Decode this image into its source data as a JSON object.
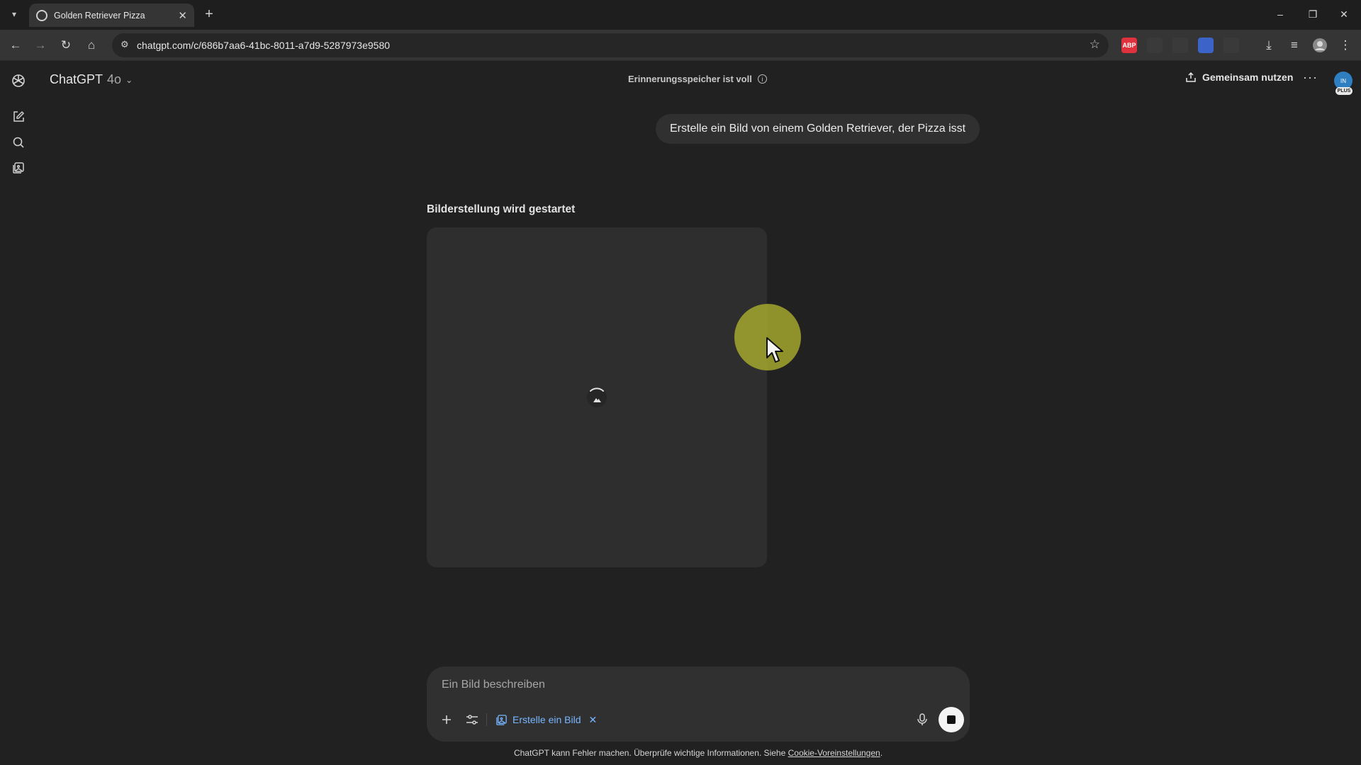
{
  "browser": {
    "tab_title": "Golden Retriever Pizza",
    "url": "chatgpt.com/c/686b7aa6-41bc-8011-a7d9-5287973e9580",
    "extensions": [
      {
        "name": "abp-extension-icon",
        "label": "ABP",
        "color": "#e0323c"
      },
      {
        "name": "swoosh-extension-icon",
        "label": "",
        "color": "#3a3a3a"
      },
      {
        "name": "camera-extension-icon",
        "label": "",
        "color": "#3a3a3a"
      },
      {
        "name": "shield-extension-icon",
        "label": "",
        "color": "#3c63c8"
      },
      {
        "name": "puzzle-extension-icon",
        "label": "",
        "color": "#3a3a3a"
      }
    ]
  },
  "header": {
    "model_name": "ChatGPT",
    "model_version": "4o",
    "memory_notice": "Erinnerungsspeicher ist voll",
    "share_label": "Gemeinsam nutzen",
    "avatar_initials": "IN",
    "plan_badge": "PLUS"
  },
  "conversation": {
    "user_message": "Erstelle ein Bild von einem Golden Retriever, der Pizza isst",
    "image_status": "Bilderstellung wird gestartet"
  },
  "composer": {
    "placeholder": "Ein Bild beschreiben",
    "tool_pill": "Erstelle ein Bild"
  },
  "footer": {
    "disclaimer": "ChatGPT kann Fehler machen. Überprüfe wichtige Informationen. Siehe",
    "link": "Cookie-Voreinstellungen",
    "tail": "."
  },
  "colors": {
    "background": "#212121",
    "accent_link": "#78b6ff",
    "cursor_highlight": "#babe2e"
  }
}
